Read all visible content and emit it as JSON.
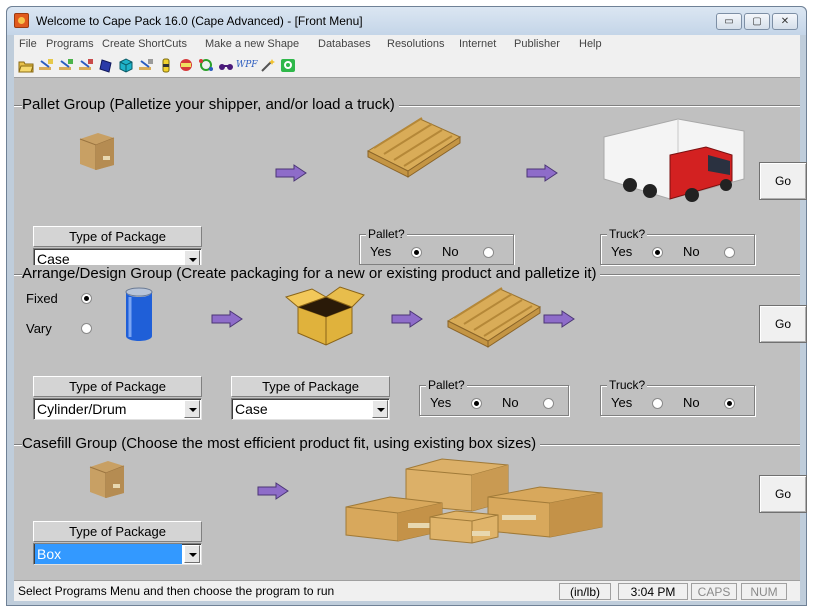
{
  "window": {
    "title": "Welcome to Cape Pack 16.0 (Cape Advanced) - [Front Menu]",
    "controls": {
      "minimize": "▭",
      "maximize": "▢",
      "close": "✕"
    }
  },
  "menu": [
    "File",
    "Programs",
    "Create ShortCuts",
    "Make a new Shape",
    "Databases",
    "Resolutions",
    "Internet",
    "Publisher",
    "Help"
  ],
  "toolbar": {
    "icons": [
      "open-folder-icon",
      "pallet-tool-icon",
      "arrange-tool-icon",
      "design-tool-icon",
      "shape-tool-icon",
      "box-3d-icon",
      "casefill-tool-icon",
      "bottle-icon",
      "pallet-2-icon",
      "network-icon",
      "glasses-icon",
      "wpf-icon",
      "wizard-wand-icon",
      "green-square-icon"
    ],
    "wpf_label": "WPF"
  },
  "pallet_group": {
    "title": "Pallet Group (Palletize your shipper, and/or load a truck)",
    "go": "Go",
    "type_label": "Type of Package",
    "type_value": "Case",
    "pallet": {
      "legend": "Pallet?",
      "yes": "Yes",
      "no": "No",
      "selected": "Yes"
    },
    "truck": {
      "legend": "Truck?",
      "yes": "Yes",
      "no": "No",
      "selected": "Yes"
    }
  },
  "arrange_group": {
    "title": "Arrange/Design Group (Create packaging for a new or existing product and palletize it)",
    "go": "Go",
    "fixed_label": "Fixed",
    "vary_label": "Vary",
    "mode_selected": "Fixed",
    "type1_label": "Type of Package",
    "type1_value": "Cylinder/Drum",
    "type2_label": "Type of Package",
    "type2_value": "Case",
    "pallet": {
      "legend": "Pallet?",
      "yes": "Yes",
      "no": "No",
      "selected": "Yes"
    },
    "truck": {
      "legend": "Truck?",
      "yes": "Yes",
      "no": "No",
      "selected": "No"
    }
  },
  "casefill_group": {
    "title": "Casefill Group (Choose the most efficient product fit, using existing box sizes)",
    "go": "Go",
    "type_label": "Type of Package",
    "type_value": "Box"
  },
  "status": {
    "message": "Select Programs Menu and then choose the program to run",
    "units": "(in/lb)",
    "time": "3:04 PM",
    "caps": "CAPS",
    "num": "NUM"
  },
  "colors": {
    "arrow": "#8e6cc9",
    "pallet_wood": "#d9ac58",
    "cardboard": "#c8a064",
    "can_blue": "#1f5fd8",
    "selection": "#3399ff"
  }
}
